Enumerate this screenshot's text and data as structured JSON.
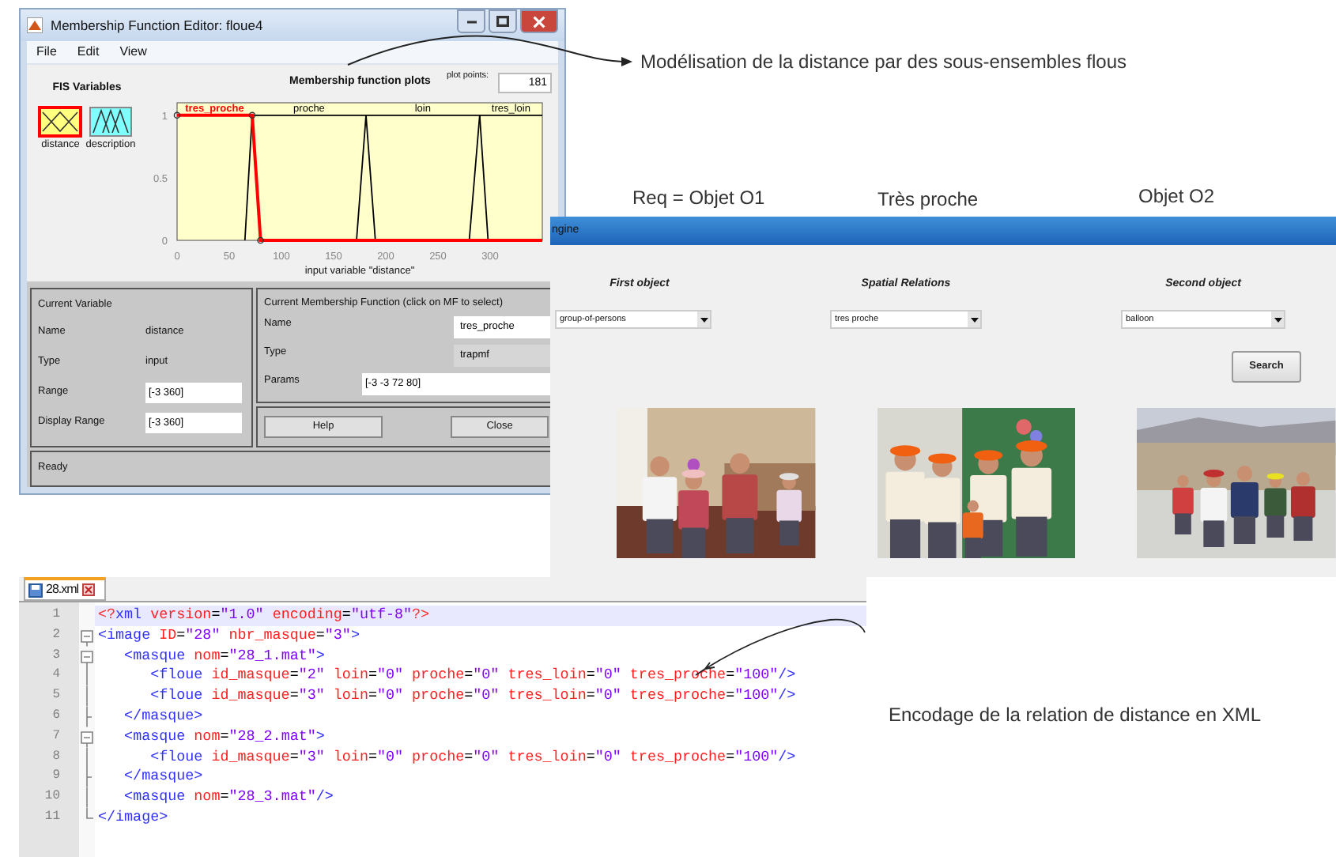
{
  "annotations": {
    "model_note": "Modélisation de la distance par des sous-ensembles flous",
    "query_label": "Req = Objet O1",
    "relation_label": "Très proche",
    "object_label": "Objet O2",
    "xml_note": "Encodage de la relation de distance en XML"
  },
  "mf_editor": {
    "title": "Membership Function Editor: floue4",
    "menu": [
      "File",
      "Edit",
      "View"
    ],
    "fis_title": "FIS Variables",
    "variables": [
      {
        "label": "distance",
        "kind": "input",
        "selected": true
      },
      {
        "label": "description",
        "kind": "output",
        "selected": false
      }
    ],
    "plot_title": "Membership function plots",
    "plot_points_label": "plot points:",
    "plot_points": "181",
    "chart_data": {
      "type": "line",
      "xlabel": "input variable \"distance\"",
      "x": [
        0,
        65,
        72,
        80,
        172,
        181,
        190,
        280,
        290,
        298,
        350
      ],
      "series": [
        {
          "name": "tres_proche",
          "color": "#ff0000",
          "values": [
            1,
            1,
            1,
            0,
            0,
            0,
            0,
            0,
            0,
            0,
            0
          ]
        },
        {
          "name": "proche",
          "color": "#000000",
          "values": [
            null,
            0,
            1,
            1,
            1,
            1,
            0,
            null,
            null,
            null,
            null
          ]
        },
        {
          "name": "loin",
          "color": "#000000",
          "values": [
            null,
            null,
            null,
            null,
            0,
            1,
            1,
            1,
            1,
            0,
            null
          ]
        },
        {
          "name": "tres_loin",
          "color": "#000000",
          "values": [
            null,
            null,
            null,
            null,
            null,
            null,
            null,
            0,
            1,
            1,
            1
          ]
        }
      ],
      "xlim": [
        0,
        350
      ],
      "ylim": [
        0,
        1.1
      ],
      "xticks": [
        0,
        50,
        100,
        150,
        200,
        250,
        300
      ],
      "yticks": [
        0,
        0.5,
        1
      ]
    },
    "current_variable": {
      "title": "Current Variable",
      "rows": [
        {
          "label": "Name",
          "value": "distance",
          "kind": "text"
        },
        {
          "label": "Type",
          "value": "input",
          "kind": "text"
        },
        {
          "label": "Range",
          "value": "[-3 360]",
          "kind": "field"
        },
        {
          "label": "Display Range",
          "value": "[-3 360]",
          "kind": "field"
        }
      ]
    },
    "current_mf": {
      "title": "Current Membership Function (click on MF to select)",
      "rows": [
        {
          "label": "Name",
          "value": "tres_proche",
          "kind": "field"
        },
        {
          "label": "Type",
          "value": "trapmf",
          "kind": "readonly"
        },
        {
          "label": "Params",
          "value": "[-3 -3 72 80]",
          "kind": "wide"
        }
      ]
    },
    "buttons": [
      "Help",
      "Close"
    ],
    "status": "Ready"
  },
  "search_window": {
    "title": "ngine",
    "columns": [
      {
        "label": "First object",
        "value": "group-of-persons"
      },
      {
        "label": "Spatial Relations",
        "value": "tres proche"
      },
      {
        "label": "Second object",
        "value": "balloon"
      }
    ],
    "search_button": "Search"
  },
  "code_editor": {
    "tab": "28.xml",
    "lines": [
      {
        "number": "1",
        "text": "<?xml version=\"1.0\" encoding=\"utf-8\"?>",
        "kind": "plain",
        "selected": true
      },
      {
        "number": "2",
        "text": "<image ID=\"28\" nbr_masque=\"3\">",
        "kind": "fold",
        "selected": false
      },
      {
        "number": "3",
        "text": "   <masque nom=\"28_1.mat\">",
        "kind": "fold",
        "selected": false
      },
      {
        "number": "4",
        "text": "      <floue id_masque=\"2\" loin=\"0\" proche=\"0\" tres_loin=\"0\" tres_proche=\"100\"/>",
        "kind": "inside",
        "selected": false
      },
      {
        "number": "5",
        "text": "      <floue id_masque=\"3\" loin=\"0\" proche=\"0\" tres_loin=\"0\" tres_proche=\"100\"/>",
        "kind": "inside",
        "selected": false
      },
      {
        "number": "6",
        "text": "   </masque>",
        "kind": "end",
        "selected": false
      },
      {
        "number": "7",
        "text": "   <masque nom=\"28_2.mat\">",
        "kind": "fold",
        "selected": false
      },
      {
        "number": "8",
        "text": "      <floue id_masque=\"3\" loin=\"0\" proche=\"0\" tres_loin=\"0\" tres_proche=\"100\"/>",
        "kind": "inside",
        "selected": false
      },
      {
        "number": "9",
        "text": "   </masque>",
        "kind": "end",
        "selected": false
      },
      {
        "number": "10",
        "text": "   <masque nom=\"28_3.mat\"/>",
        "kind": "inside",
        "selected": false
      },
      {
        "number": "11",
        "text": "</image>",
        "kind": "last",
        "selected": false
      }
    ]
  }
}
